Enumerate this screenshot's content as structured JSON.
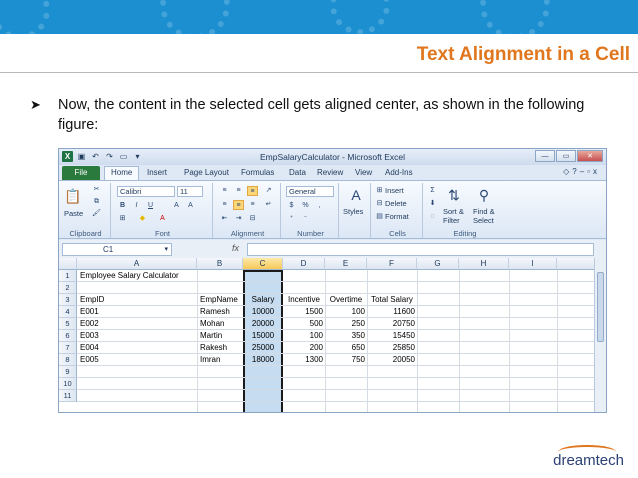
{
  "slide": {
    "title": "Text Alignment in a Cell",
    "bullet": "Now, the content in the selected cell gets aligned center, as shown in the following figure:",
    "logo_text": "dreamtech",
    "colors": {
      "header_band": "#1c8fd0",
      "title": "#e0761d"
    }
  },
  "excel": {
    "window_title": "EmpSalaryCalculator - Microsoft Excel",
    "tabs": [
      "File",
      "Home",
      "Insert",
      "Page Layout",
      "Formulas",
      "Data",
      "Review",
      "View",
      "Add-Ins"
    ],
    "ribbon": {
      "paste": "Paste",
      "clipboard": "Clipboard",
      "font_name": "Calibri",
      "font_size": "11",
      "font": "Font",
      "alignment": "Alignment",
      "number_format": "General",
      "number": "Number",
      "styles": "Styles",
      "insert": "Insert",
      "delete": "Delete",
      "format": "Format",
      "cells": "Cells",
      "sort_filter_1": "Sort &",
      "sort_filter_2": "Filter",
      "find_select_1": "Find &",
      "find_select_2": "Select",
      "editing": "Editing"
    },
    "name_box": "C1",
    "fx": "fx",
    "columns": [
      "A",
      "B",
      "C",
      "D",
      "E",
      "F",
      "G",
      "H",
      "I"
    ],
    "rows": [
      "1",
      "2",
      "3",
      "4",
      "5",
      "6",
      "7",
      "8",
      "9",
      "10",
      "11"
    ],
    "sheet_title": "Employee Salary Calculator",
    "headers": [
      "EmpID",
      "EmpName",
      "Salary",
      "Incentive",
      "Overtime",
      "Total Salary"
    ],
    "data": [
      [
        "E001",
        "Ramesh",
        "10000",
        "1500",
        "100",
        "11600"
      ],
      [
        "E002",
        "Mohan",
        "20000",
        "500",
        "250",
        "20750"
      ],
      [
        "E003",
        "Martin",
        "15000",
        "100",
        "350",
        "15450"
      ],
      [
        "E004",
        "Rakesh",
        "25000",
        "200",
        "650",
        "25850"
      ],
      [
        "E005",
        "Imran",
        "18000",
        "1300",
        "750",
        "20050"
      ]
    ],
    "selected_column": "C"
  }
}
